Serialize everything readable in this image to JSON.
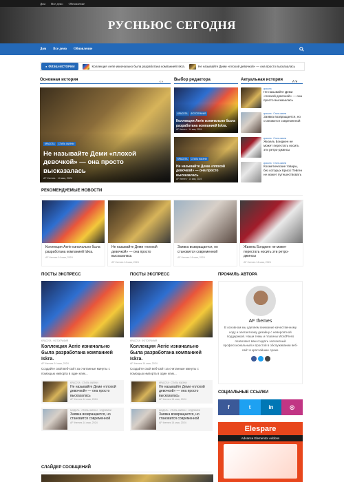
{
  "topbar": {
    "links": [
      "Дом",
      "Все демо",
      "Обновление"
    ]
  },
  "site": {
    "title": "РУСНЬЮС СЕГОДНЯ"
  },
  "nav": {
    "links": [
      "Дом",
      "Все демо",
      "Обновление"
    ]
  },
  "ticker": {
    "label": "ФЛЭШ-ИСТОРИИ",
    "items": [
      "Коллекция Aerie изначально была разработана компанией Iskra.",
      "Не называйте Деми «плохой девочкой» — она просто высказалась"
    ]
  },
  "main": {
    "heading": "Основная история",
    "cats": [
      "красота",
      "Стиль жизни"
    ],
    "title": "Не называйте Деми «плохой девочкой» — она просто высказалась",
    "author": "AF themes",
    "date": "14 мая, 2024"
  },
  "editor": {
    "heading": "Выбор редактора",
    "cards": [
      {
        "cats": [
          "красота",
          "фотография"
        ],
        "title": "Коллекция Aerie изначально была разработана компанией Iskra.",
        "author": "AF themes",
        "date": "14 мая, 2024"
      },
      {
        "cats": [
          "красота",
          "Стиль жизни"
        ],
        "title": "Не называйте Деми «плохой девочкой» — она просто высказалась",
        "author": "AF themes",
        "date": "14 мая, 2024"
      }
    ]
  },
  "trending": {
    "heading": "Актуальная история",
    "items": [
      {
        "cats": "красота",
        "title": "Не называйте Деми «плохой девочкой» — она просто высказалась"
      },
      {
        "cats": "красота · Стиль жизни",
        "title": "Заявка возвращается, но становится современной"
      },
      {
        "cats": "красота · Стиль жизни",
        "title": "Жизель Бэнджен не может перестать носить эти ретро-джинсы"
      },
      {
        "cats": "красота · Стиль жизни",
        "title": "Косметические товары, без которых Криссі Тейген не может путешествовать"
      }
    ]
  },
  "recommended": {
    "heading": "РЕКОМЕНДУЕМЫЕ НОВОСТИ",
    "cards": [
      {
        "cats": [
          "красота",
          "фотография"
        ],
        "title": "Коллекция Aerie изначально была разработана компанией Iskra.",
        "meta": "AF themes  14 мая, 2024"
      },
      {
        "cats": [
          "красота",
          "Стиль жизни"
        ],
        "title": "Не называйте Деми «плохой девочкой» — она просто высказалась",
        "meta": "AF themes  14 мая, 2024"
      },
      {
        "cats": [
          "красота",
          "Стиль жизни",
          "Ходовики"
        ],
        "title": "Заявка возвращается, но становится современной",
        "meta": "AF themes  14 мая, 2024"
      },
      {
        "cats": [
          "Стиль жизни",
          "Путешествия"
        ],
        "title": "Жизель Бэнджен не может перестать носить эти ретро-джинсы",
        "meta": "AF themes  14 мая, 2024"
      }
    ]
  },
  "express": [
    {
      "heading": "ПОСТЫ ЭКСПРЕСС",
      "cats": "КРАСОТА · ФОТОГРАФИЯ",
      "title": "Коллекция Aerie изначально была разработана компанией Iskra.",
      "meta": "AF themes  14 мая, 2024",
      "desc": "Создайте свой веб-сайт за считанные минуты с помощью импорта в один клик...",
      "small": [
        {
          "cats": "КРАСОТА · СТИЛЬ ЖИЗНИ",
          "title": "Не называйте Деми «плохой девочкой» — она просто высказалась",
          "meta": "AF themes  14 мая, 2024"
        },
        {
          "cats": "МОДЕЛЬ · СТИЛЬ ЖИЗНИ · ХОДОВИКИ",
          "title": "Заявка возвращается, но становится современной",
          "meta": "AF themes  14 мая, 2024"
        }
      ]
    },
    {
      "heading": "ПОСТЫ ЭКСПРЕСС",
      "cats": "КРАСОТА · ФОТОГРАФИЯ",
      "title": "Коллекция Aerie изначально была разработана компанией Iskra.",
      "meta": "AF themes  14 мая, 2024",
      "desc": "Создайте свой веб-сайт за считанные минуты с помощью импорта в один клик...",
      "small": [
        {
          "cats": "КРАСОТА · СТИЛЬ ЖИЗНИ",
          "title": "Не называйте Деми «плохой девочкой» — она просто высказалась",
          "meta": "AF themes  14 мая, 2024"
        },
        {
          "cats": "МОДЕЛЬ · СТИЛЬ ЖИЗНИ · ХОДОВИКИ",
          "title": "Заявка возвращается, но становится современной",
          "meta": "AF themes  14 мая, 2024"
        }
      ]
    }
  ],
  "profile": {
    "heading": "ПРОФИЛЬ АВТОРА",
    "name": "AF themes",
    "bio": "В основном мы уделяем внимание качественному коду и элегантному дизайну с невероятной поддержкой. Наши темы и плагины WordPress позволяют вам создать элегантный профессиональный и простой в обслуживании веб-сайт в кратчайшие сроки."
  },
  "social": {
    "heading": "СОЦИАЛЬНЫЕ ССЫЛКИ",
    "icons": [
      "f",
      "t",
      "in",
      "◎"
    ]
  },
  "ad": {
    "title": "Elespare",
    "subtitle": "Advance Elementor Addons"
  },
  "slider": {
    "heading": "СЛАЙДЕР СООБЩЕНИЙ"
  }
}
